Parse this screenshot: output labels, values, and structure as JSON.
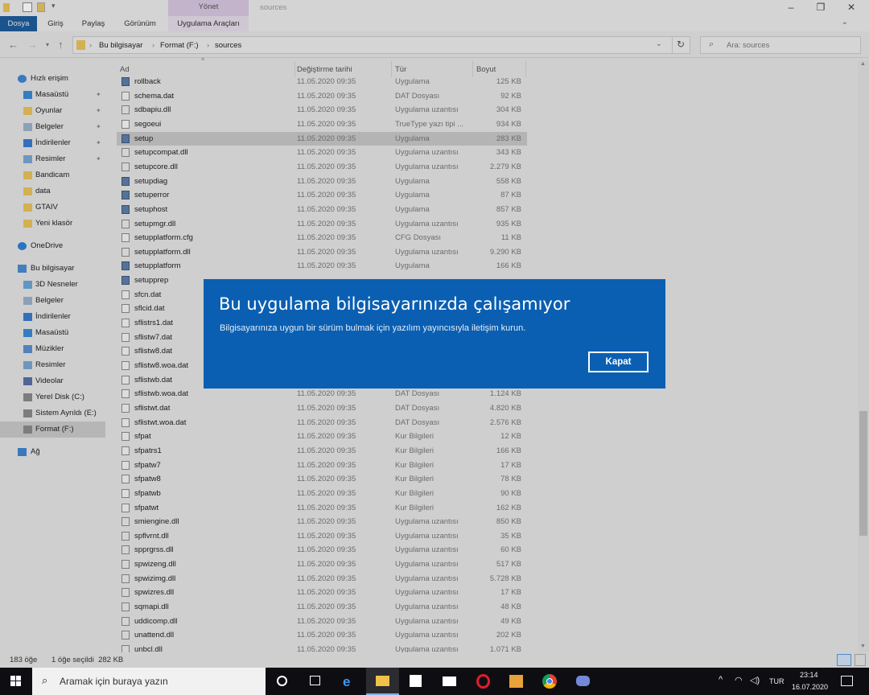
{
  "window": {
    "title": "sources",
    "manage_label": "Yönet",
    "tabs": [
      "Dosya",
      "Giriş",
      "Paylaş",
      "Görünüm",
      "Uygulama Araçları"
    ]
  },
  "address": {
    "crumbs": [
      "Bu bilgisayar",
      "Format (F:)",
      "sources"
    ],
    "search_placeholder": "Ara: sources"
  },
  "sidebar": {
    "items": [
      {
        "label": "Hızlı erişim",
        "icon": "star-icon",
        "indent": 0,
        "pinned": false
      },
      {
        "label": "Masaüstü",
        "icon": "desktop-icon",
        "indent": 1,
        "pinned": true
      },
      {
        "label": "Oyunlar",
        "icon": "folder-icon",
        "indent": 1,
        "pinned": true
      },
      {
        "label": "Belgeler",
        "icon": "documents-icon",
        "indent": 1,
        "pinned": true
      },
      {
        "label": "İndirilenler",
        "icon": "download-icon",
        "indent": 1,
        "pinned": true
      },
      {
        "label": "Resimler",
        "icon": "pictures-icon",
        "indent": 1,
        "pinned": true
      },
      {
        "label": "Bandicam",
        "icon": "folder-icon",
        "indent": 1,
        "pinned": false
      },
      {
        "label": "data",
        "icon": "folder-icon",
        "indent": 1,
        "pinned": false
      },
      {
        "label": "GTAIV",
        "icon": "folder-icon",
        "indent": 1,
        "pinned": false
      },
      {
        "label": "Yeni klasör",
        "icon": "folder-icon",
        "indent": 1,
        "pinned": false
      },
      {
        "label": "OneDrive",
        "icon": "cloud-icon",
        "indent": 0,
        "pinned": false
      },
      {
        "label": "Bu bilgisayar",
        "icon": "computer-icon",
        "indent": 0,
        "pinned": false
      },
      {
        "label": "3D Nesneler",
        "icon": "cube-icon",
        "indent": 1,
        "pinned": false
      },
      {
        "label": "Belgeler",
        "icon": "documents-icon",
        "indent": 1,
        "pinned": false
      },
      {
        "label": "İndirilenler",
        "icon": "download-icon",
        "indent": 1,
        "pinned": false
      },
      {
        "label": "Masaüstü",
        "icon": "desktop-icon",
        "indent": 1,
        "pinned": false
      },
      {
        "label": "Müzikler",
        "icon": "music-icon",
        "indent": 1,
        "pinned": false
      },
      {
        "label": "Resimler",
        "icon": "pictures-icon",
        "indent": 1,
        "pinned": false
      },
      {
        "label": "Videolar",
        "icon": "video-icon",
        "indent": 1,
        "pinned": false
      },
      {
        "label": "Yerel Disk (C:)",
        "icon": "disk-icon",
        "indent": 1,
        "pinned": false
      },
      {
        "label": "Sistem Ayrıldı (E:)",
        "icon": "disk-icon",
        "indent": 1,
        "pinned": false
      },
      {
        "label": "Format (F:)",
        "icon": "disk-icon",
        "indent": 1,
        "pinned": false,
        "selected": true
      },
      {
        "label": "Ağ",
        "icon": "network-icon",
        "indent": 0,
        "pinned": false
      }
    ]
  },
  "columns": [
    "Ad",
    "Değiştirme tarihi",
    "Tür",
    "Boyut"
  ],
  "files": [
    {
      "name": "rollback",
      "date": "11.05.2020 09:35",
      "type": "Uygulama",
      "size": "125 KB",
      "kind": "exe"
    },
    {
      "name": "schema.dat",
      "date": "11.05.2020 09:35",
      "type": "DAT Dosyası",
      "size": "92 KB",
      "kind": "dat"
    },
    {
      "name": "sdbapiu.dll",
      "date": "11.05.2020 09:35",
      "type": "Uygulama uzantısı",
      "size": "304 KB",
      "kind": "dll"
    },
    {
      "name": "segoeui",
      "date": "11.05.2020 09:35",
      "type": "TrueType yazı tipi ...",
      "size": "934 KB",
      "kind": "font"
    },
    {
      "name": "setup",
      "date": "11.05.2020 09:35",
      "type": "Uygulama",
      "size": "283 KB",
      "kind": "exe",
      "selected": true
    },
    {
      "name": "setupcompat.dll",
      "date": "11.05.2020 09:35",
      "type": "Uygulama uzantısı",
      "size": "343 KB",
      "kind": "dll"
    },
    {
      "name": "setupcore.dll",
      "date": "11.05.2020 09:35",
      "type": "Uygulama uzantısı",
      "size": "2.279 KB",
      "kind": "dll"
    },
    {
      "name": "setupdiag",
      "date": "11.05.2020 09:35",
      "type": "Uygulama",
      "size": "558 KB",
      "kind": "exe"
    },
    {
      "name": "setuperror",
      "date": "11.05.2020 09:35",
      "type": "Uygulama",
      "size": "87 KB",
      "kind": "exe"
    },
    {
      "name": "setuphost",
      "date": "11.05.2020 09:35",
      "type": "Uygulama",
      "size": "857 KB",
      "kind": "exe"
    },
    {
      "name": "setupmgr.dll",
      "date": "11.05.2020 09:35",
      "type": "Uygulama uzantısı",
      "size": "935 KB",
      "kind": "dll"
    },
    {
      "name": "setupplatform.cfg",
      "date": "11.05.2020 09:35",
      "type": "CFG Dosyası",
      "size": "11 KB",
      "kind": "dat"
    },
    {
      "name": "setupplatform.dll",
      "date": "11.05.2020 09:35",
      "type": "Uygulama uzantısı",
      "size": "9.290 KB",
      "kind": "dll"
    },
    {
      "name": "setupplatform",
      "date": "11.05.2020 09:35",
      "type": "Uygulama",
      "size": "166 KB",
      "kind": "exe"
    },
    {
      "name": "setupprep",
      "date": "",
      "type": "",
      "size": "",
      "kind": "exe"
    },
    {
      "name": "sfcn.dat",
      "date": "",
      "type": "",
      "size": "",
      "kind": "dat"
    },
    {
      "name": "sflcid.dat",
      "date": "",
      "type": "",
      "size": "",
      "kind": "dat"
    },
    {
      "name": "sflistrs1.dat",
      "date": "",
      "type": "",
      "size": "",
      "kind": "dat"
    },
    {
      "name": "sflistw7.dat",
      "date": "",
      "type": "",
      "size": "",
      "kind": "dat"
    },
    {
      "name": "sflistw8.dat",
      "date": "",
      "type": "",
      "size": "",
      "kind": "dat"
    },
    {
      "name": "sflistw8.woa.dat",
      "date": "",
      "type": "",
      "size": "",
      "kind": "dat"
    },
    {
      "name": "sflistwb.dat",
      "date": "",
      "type": "",
      "size": "",
      "kind": "dat"
    },
    {
      "name": "sflistwb.woa.dat",
      "date": "11.05.2020 09:35",
      "type": "DAT Dosyası",
      "size": "1.124 KB",
      "kind": "dat"
    },
    {
      "name": "sflistwt.dat",
      "date": "11.05.2020 09:35",
      "type": "DAT Dosyası",
      "size": "4.820 KB",
      "kind": "dat"
    },
    {
      "name": "sflistwt.woa.dat",
      "date": "11.05.2020 09:35",
      "type": "DAT Dosyası",
      "size": "2.576 KB",
      "kind": "dat"
    },
    {
      "name": "sfpat",
      "date": "11.05.2020 09:35",
      "type": "Kur Bilgileri",
      "size": "12 KB",
      "kind": "dat"
    },
    {
      "name": "sfpatrs1",
      "date": "11.05.2020 09:35",
      "type": "Kur Bilgileri",
      "size": "166 KB",
      "kind": "dat"
    },
    {
      "name": "sfpatw7",
      "date": "11.05.2020 09:35",
      "type": "Kur Bilgileri",
      "size": "17 KB",
      "kind": "dat"
    },
    {
      "name": "sfpatw8",
      "date": "11.05.2020 09:35",
      "type": "Kur Bilgileri",
      "size": "78 KB",
      "kind": "dat"
    },
    {
      "name": "sfpatwb",
      "date": "11.05.2020 09:35",
      "type": "Kur Bilgileri",
      "size": "90 KB",
      "kind": "dat"
    },
    {
      "name": "sfpatwt",
      "date": "11.05.2020 09:35",
      "type": "Kur Bilgileri",
      "size": "162 KB",
      "kind": "dat"
    },
    {
      "name": "smiengine.dll",
      "date": "11.05.2020 09:35",
      "type": "Uygulama uzantısı",
      "size": "850 KB",
      "kind": "dll"
    },
    {
      "name": "spflvrnt.dll",
      "date": "11.05.2020 09:35",
      "type": "Uygulama uzantısı",
      "size": "35 KB",
      "kind": "dll"
    },
    {
      "name": "spprgrss.dll",
      "date": "11.05.2020 09:35",
      "type": "Uygulama uzantısı",
      "size": "60 KB",
      "kind": "dll"
    },
    {
      "name": "spwizeng.dll",
      "date": "11.05.2020 09:35",
      "type": "Uygulama uzantısı",
      "size": "517 KB",
      "kind": "dll"
    },
    {
      "name": "spwizimg.dll",
      "date": "11.05.2020 09:35",
      "type": "Uygulama uzantısı",
      "size": "5.728 KB",
      "kind": "dll"
    },
    {
      "name": "spwizres.dll",
      "date": "11.05.2020 09:35",
      "type": "Uygulama uzantısı",
      "size": "17 KB",
      "kind": "dll"
    },
    {
      "name": "sqmapi.dll",
      "date": "11.05.2020 09:35",
      "type": "Uygulama uzantısı",
      "size": "48 KB",
      "kind": "dll"
    },
    {
      "name": "uddicomp.dll",
      "date": "11.05.2020 09:35",
      "type": "Uygulama uzantısı",
      "size": "49 KB",
      "kind": "dll"
    },
    {
      "name": "unattend.dll",
      "date": "11.05.2020 09:35",
      "type": "Uygulama uzantısı",
      "size": "202 KB",
      "kind": "dll"
    },
    {
      "name": "unbcl.dll",
      "date": "11.05.2020 09:35",
      "type": "Uygulama uzantısı",
      "size": "1.071 KB",
      "kind": "dll"
    }
  ],
  "status": {
    "count": "183 öğe",
    "selected": "1 öğe seçildi  282 KB"
  },
  "dialog": {
    "title": "Bu uygulama bilgisayarınızda çalışamıyor",
    "message": "Bilgisayarınıza uygun bir sürüm bulmak için yazılım yayıncısıyla iletişim kurun.",
    "button": "Kapat",
    "color": "#0a5fb2"
  },
  "taskbar": {
    "search_placeholder": "Aramak için buraya yazın",
    "apps": [
      "cortana-icon",
      "task-view-icon",
      "edge-icon",
      "file-explorer-icon",
      "store-icon",
      "mail-icon",
      "opera-icon",
      "media-player-icon",
      "chrome-icon",
      "discord-icon"
    ],
    "language": "TUR",
    "time": "23:14",
    "date": "16.07.2020"
  }
}
